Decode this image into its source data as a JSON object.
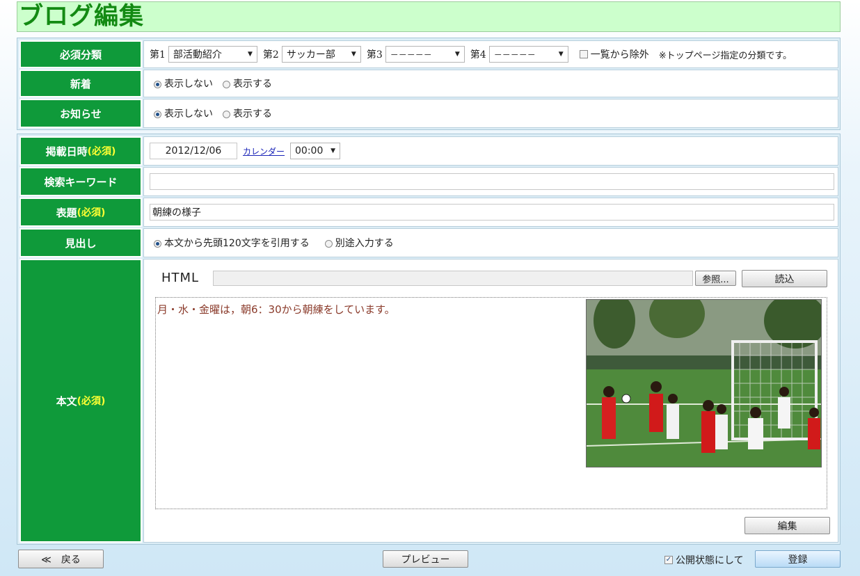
{
  "page": {
    "title": "ブログ編集"
  },
  "category": {
    "label": "必須分類",
    "c1_prefix": "第1",
    "c1_value": "部活動紹介",
    "c2_prefix": "第2",
    "c2_value": "サッカー部",
    "c3_prefix": "第3",
    "c3_value": "－－－－－",
    "c4_prefix": "第4",
    "c4_value": "－－－－－",
    "exclude_label": "一覧から除外",
    "note": "※トップページ指定の分類です。"
  },
  "new": {
    "label": "新着",
    "opt_hide": "表示しない",
    "opt_show": "表示する"
  },
  "notice": {
    "label": "お知らせ",
    "opt_hide": "表示しない",
    "opt_show": "表示する"
  },
  "date": {
    "label": "掲載日時",
    "required": "(必須)",
    "value": "2012/12/06",
    "calendar_link": "カレンダー",
    "time_value": "00:00"
  },
  "keyword": {
    "label": "検索キーワード",
    "value": ""
  },
  "subject": {
    "label": "表題",
    "required": "(必須)",
    "value": "朝練の様子"
  },
  "heading": {
    "label": "見出し",
    "opt_quote": "本文から先頭120文字を引用する",
    "opt_separate": "別途入力する"
  },
  "body": {
    "label": "本文",
    "required": "(必須)",
    "html_label": "HTML",
    "file_value": "",
    "browse_button": "参照...",
    "load_button": "読込",
    "text": "月・水・金曜は，朝6：30から朝練をしています。",
    "edit_button": "編集"
  },
  "footer": {
    "back_button": "≪　戻る",
    "preview_button": "プレビュー",
    "publish_label": "公開状態にして",
    "register_button": "登録"
  },
  "colors": {
    "label_green": "#0f9a3a",
    "title_green": "#138a13",
    "required_yellow": "#ffff33"
  }
}
